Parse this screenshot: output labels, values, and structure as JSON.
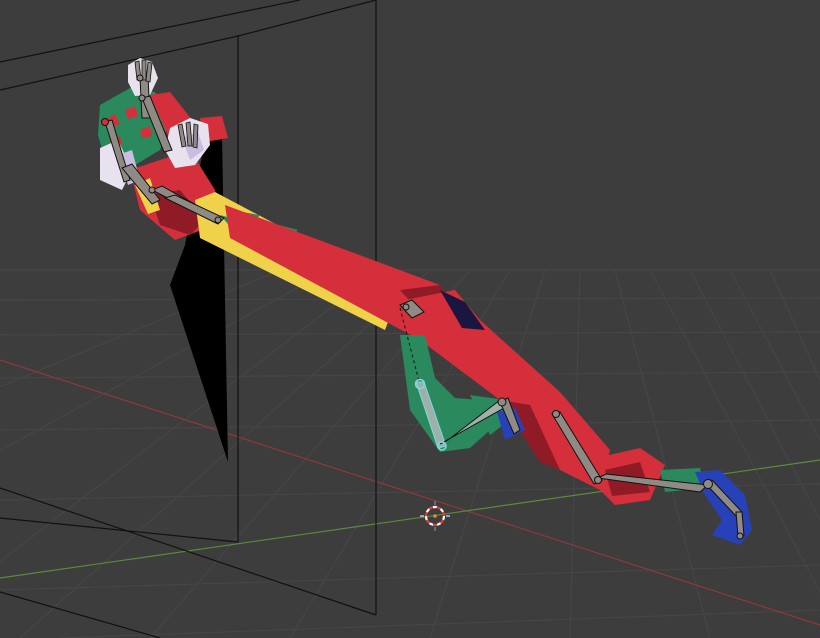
{
  "viewport": {
    "background": "#3d3d3d",
    "grid_color": "#474747",
    "x_axis_color": "#8c3a3a",
    "y_axis_color": "#5d8a3a",
    "wireframe_color": "#111111",
    "shadow_plane_color": "#000000"
  },
  "scene": {
    "object": "posed-character-mesh-with-armature",
    "mesh_colors": {
      "red": "#d42f3a",
      "dark_red": "#8f1b27",
      "green": "#2a8a5e",
      "yellow": "#f0d24a",
      "blue": "#2742b8",
      "white": "#e8e2ee",
      "lavender": "#c9bde0",
      "navy": "#1a1640"
    },
    "bone_fill": "#8f8a84",
    "bone_outline": "#111111",
    "bone_selected": "#7fd8e0"
  },
  "cursor_3d": {
    "icon": "3d-cursor-icon",
    "ring_color_a": "#e23b3b",
    "ring_color_b": "#ffffff"
  }
}
